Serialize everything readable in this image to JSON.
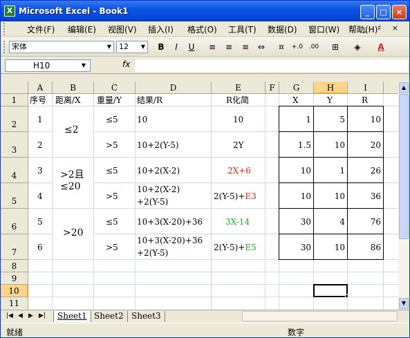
{
  "window": {
    "title": "Microsoft Excel - Book1",
    "icon": "excel-icon",
    "min": "_",
    "max": "□",
    "close": "×"
  },
  "menu": [
    "文件(F)",
    "编辑(E)",
    "视图(V)",
    "插入(I)",
    "格式(O)",
    "工具(T)",
    "数据(D)",
    "窗口(W)",
    "帮助(H)"
  ],
  "doc_buttons": "_ ♯ ×",
  "toolbar": {
    "font": "宋体",
    "size": "12",
    "bold": "B",
    "italic": "I",
    "underline": "U"
  },
  "name_box": "H10",
  "fx": "fx",
  "columns": [
    "A",
    "B",
    "C",
    "D",
    "E",
    "F",
    "G",
    "H",
    "I"
  ],
  "rows": [
    "1",
    "2",
    "3",
    "4",
    "5",
    "6",
    "7",
    "8",
    "9",
    "10",
    "11"
  ],
  "cells": {
    "A1": "序号",
    "B1": "距离/X",
    "C1": "重量/Y",
    "D1": "结果/R",
    "E1": "R化简",
    "G1": "X",
    "H1": "Y",
    "I1": "R",
    "A2": "1",
    "A4": "2",
    "A6": "3",
    "A8": "4",
    "A10": "5",
    "A12": "6",
    "B23": "≤2",
    "B45a": ">2且",
    "B45b": "≤20",
    "B67": ">20",
    "C2": "≤5",
    "C3": ">5",
    "C4": "≤5",
    "C5": ">5",
    "C6": "≤5",
    "C7": ">5",
    "D2": "10",
    "D3": "10+2(Y-5)",
    "D4": "10+2(X-2)",
    "D5a": "10+2(X-2)",
    "D5b": "+2(Y-5)",
    "D6": "10+3(X-20)+36",
    "D7a": "10+3(X-20)+36",
    "D7b": "+2(Y-5)",
    "E2": "10",
    "E3": "2Y",
    "E4": "2X+6",
    "E5a": "2(Y-5)+",
    "E5b": "E3",
    "E6": "3X-14",
    "E7a": "2(Y-5)+",
    "E7b": "E5",
    "G2": "1",
    "H2": "5",
    "I2": "10",
    "G3": "1.5",
    "H3": "10",
    "I3": "20",
    "G4": "10",
    "H4": "1",
    "I4": "26",
    "G5": "10",
    "H5": "10",
    "I5": "36",
    "G6": "30",
    "H6": "4",
    "I6": "76",
    "G7": "30",
    "H7": "10",
    "I7": "86"
  },
  "colors": {
    "red": "#E02020",
    "green": "#22B022"
  },
  "sheets": [
    "Sheet1",
    "Sheet2",
    "Sheet3"
  ],
  "status": {
    "left": "就绪",
    "right": "数字"
  }
}
